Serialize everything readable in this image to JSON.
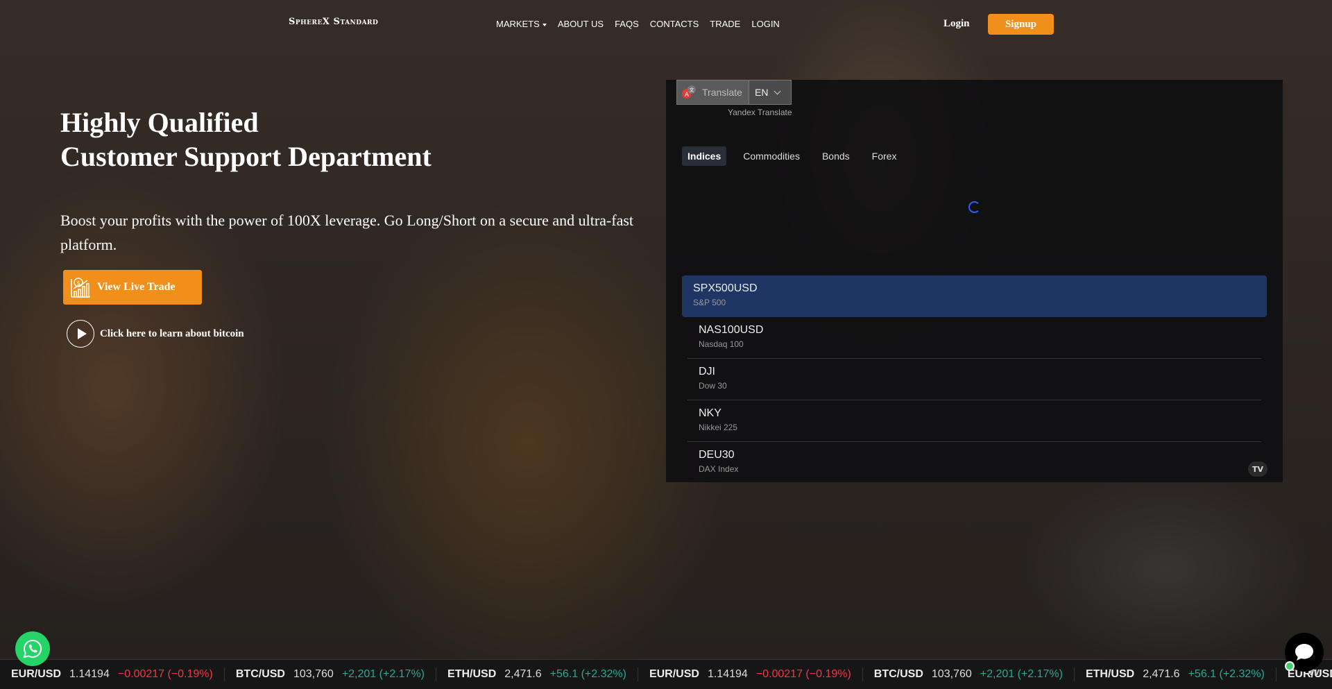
{
  "header": {
    "logo": "SphereX Standard",
    "nav": [
      "MARKETS",
      "ABOUT US",
      "FAQS",
      "CONTACTS",
      "TRADE",
      "LOGIN"
    ],
    "login_label": "Login",
    "signup_label": "Signup"
  },
  "hero": {
    "title_line1": "Highly Qualified",
    "title_line2": "Customer Support Department",
    "subtitle": "Boost your profits with the power of 100X leverage. Go Long/Short on a secure and ultra-fast platform.",
    "live_trade_label": "View Live Trade",
    "learn_label": "Click here to learn about bitcoin"
  },
  "widget": {
    "translate_label": "Translate",
    "language": "EN",
    "provider": "Yandex Translate",
    "tabs": [
      "Indices",
      "Commodities",
      "Bonds",
      "Forex"
    ],
    "active_tab": "Indices",
    "symbols": [
      {
        "symbol": "SPX500USD",
        "name": "S&P 500"
      },
      {
        "symbol": "NAS100USD",
        "name": "Nasdaq 100"
      },
      {
        "symbol": "DJI",
        "name": "Dow 30"
      },
      {
        "symbol": "NKY",
        "name": "Nikkei 225"
      },
      {
        "symbol": "DEU30",
        "name": "DAX Index"
      }
    ],
    "tv_logo": "TV"
  },
  "ticker": [
    {
      "symbol": "EUR/USD",
      "value": "1.14194",
      "change": "−0.00217 (−0.19%)",
      "dir": "down"
    },
    {
      "symbol": "BTC/USD",
      "value": "103,760",
      "change": "+2,201 (+2.17%)",
      "dir": "up"
    },
    {
      "symbol": "ETH/USD",
      "value": "2,471.6",
      "change": "+56.1 (+2.32%)",
      "dir": "up"
    },
    {
      "symbol": "EUR/USD",
      "value": "1.14194",
      "change": "−0.00217 (−0.19%)",
      "dir": "down"
    },
    {
      "symbol": "BTC/USD",
      "value": "103,760",
      "change": "+2,201 (+2.17%)",
      "dir": "up"
    },
    {
      "symbol": "ETH/USD",
      "value": "2,471.6",
      "change": "+56.1 (+2.32%)",
      "dir": "up"
    },
    {
      "symbol": "EUR/USD",
      "value": "",
      "change": "",
      "dir": "down"
    }
  ],
  "colors": {
    "accent": "#f0901a",
    "active_row": "#1f3563",
    "up": "#22ab94",
    "down": "#f23645"
  }
}
